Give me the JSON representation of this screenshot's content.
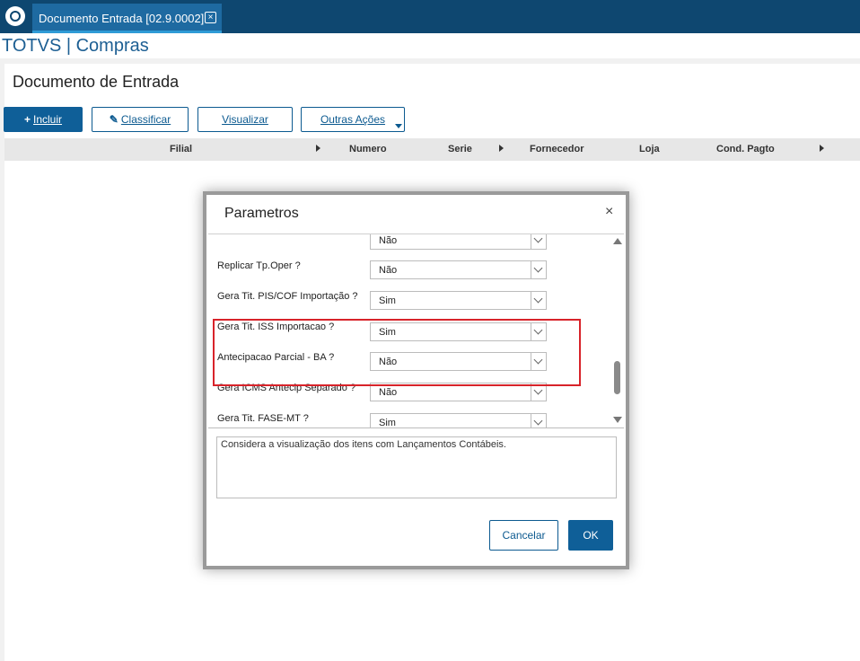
{
  "tab": {
    "title": "Documento Entrada [02.9.0002]"
  },
  "app_title": "TOTVS | Compras",
  "page_title": "Documento de Entrada",
  "toolbar": {
    "incluir": "Incluir",
    "classificar": "Classificar",
    "visualizar": "Visualizar",
    "outras_acoes": "Outras Ações"
  },
  "grid": {
    "columns": [
      "Filial",
      "Numero",
      "Serie",
      "Fornecedor",
      "Loja",
      "Cond. Pagto"
    ]
  },
  "dialog": {
    "title": "Parametros",
    "close_glyph": "×",
    "params": [
      {
        "label": "",
        "value": "Não"
      },
      {
        "label": "Replicar Tp.Oper ?",
        "value": "Não"
      },
      {
        "label": "Gera Tit. PIS/COF Importação ?",
        "value": "Sim"
      },
      {
        "label": "Gera Tit. ISS Importacao ?",
        "value": "Sim"
      },
      {
        "label": "Antecipacao Parcial - BA ?",
        "value": "Não"
      },
      {
        "label": "Gera ICMS Antecip Separado ?",
        "value": "Não"
      },
      {
        "label": "Gera Tit. FASE-MT ?",
        "value": "Sim"
      }
    ],
    "help_text": "Considera a visualização dos itens com  Lançamentos Contábeis.",
    "cancel_label": "Cancelar",
    "ok_label": "OK"
  },
  "colors": {
    "brand": "#0f5f98",
    "topbar": "#0e4770",
    "highlight": "#d8232a"
  }
}
